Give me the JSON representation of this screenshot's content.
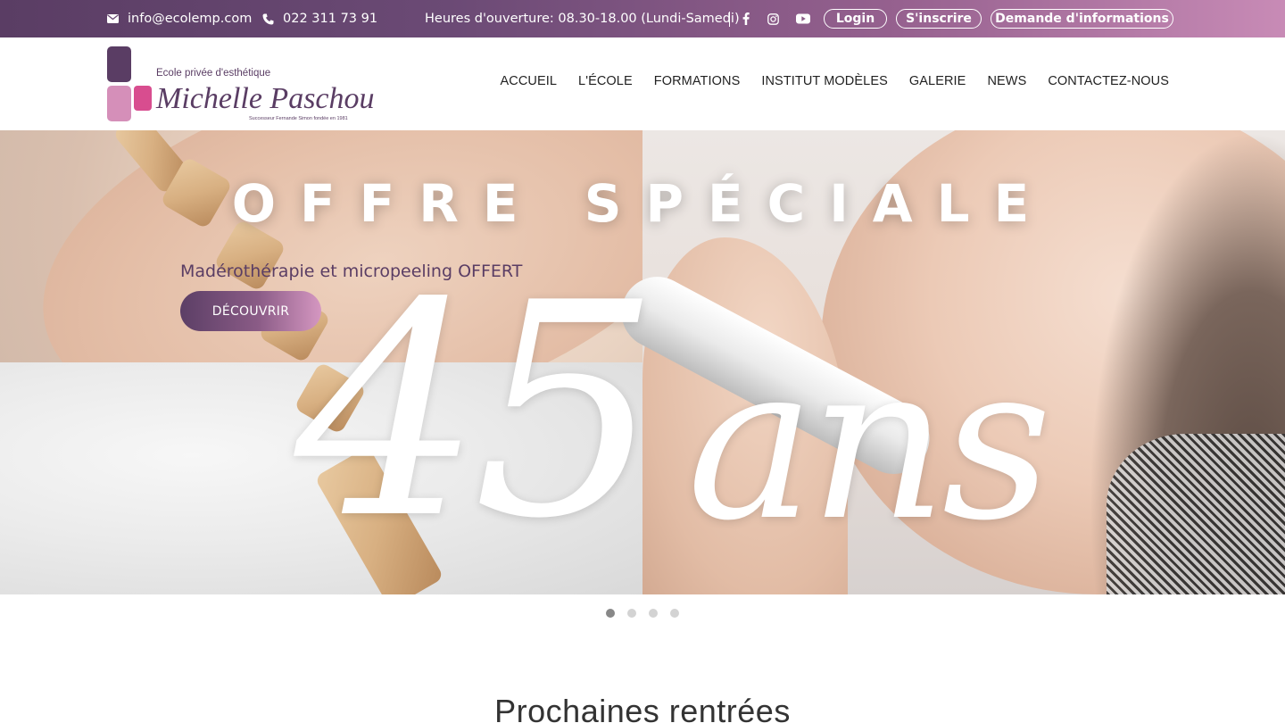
{
  "topbar": {
    "email": "info@ecolemp.com",
    "phone": "022 311 73 91",
    "hours": "Heures d'ouverture: 08.30-18.00 (Lundi-Samedi)",
    "social": [
      "facebook-icon",
      "instagram-icon",
      "youtube-icon"
    ],
    "login_label": "Login",
    "signup_label": "S'inscrire",
    "info_label": "Demande d'informations"
  },
  "logo": {
    "tagline": "Ecole privée d'esthétique",
    "name": "Michelle Paschoud",
    "subline": "Successeur Fernande Simon fondée en 1981"
  },
  "nav": {
    "items": [
      "ACCUEIL",
      "L'ÉCOLE",
      "FORMATIONS",
      "INSTITUT MODÈLES",
      "GALERIE",
      "NEWS",
      "CONTACTEZ-NOUS"
    ]
  },
  "hero": {
    "headline": "OFFRE SPÉCIALE",
    "number": "45",
    "number_suffix": "ans",
    "caption": "Madérothérapie et micropeeling OFFERT",
    "button_label": "DÉCOUVRIR",
    "slides": 4,
    "active_slide": 1
  },
  "section": {
    "title": "Prochaines rentrées"
  },
  "colors": {
    "brand_dark": "#5a3d64",
    "brand_pink": "#d597c1"
  }
}
